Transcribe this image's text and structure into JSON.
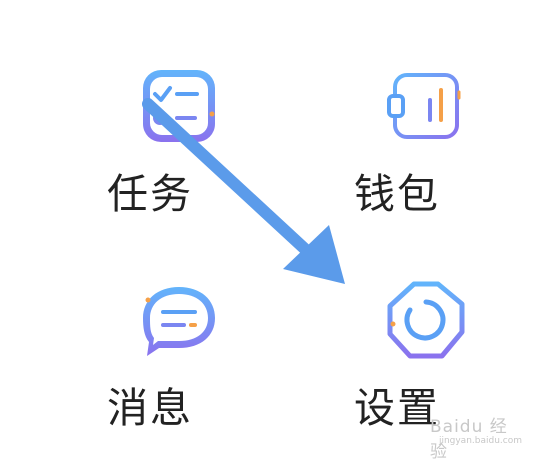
{
  "grid": {
    "items": [
      {
        "label": "任务",
        "icon": "task-checklist-icon"
      },
      {
        "label": "钱包",
        "icon": "wallet-icon"
      },
      {
        "label": "消息",
        "icon": "message-bubble-icon"
      },
      {
        "label": "设置",
        "icon": "settings-octagon-icon"
      }
    ]
  },
  "annotation": {
    "icon": "arrow-icon",
    "color": "#5b9bea"
  },
  "watermark": {
    "brand": "Baidu 经验",
    "url": "jingyan.baidu.com"
  },
  "colors": {
    "icon_blue": "#5aa0f5",
    "icon_purple": "#8a72ee",
    "accent_orange": "#f5a048",
    "text": "#222222"
  }
}
